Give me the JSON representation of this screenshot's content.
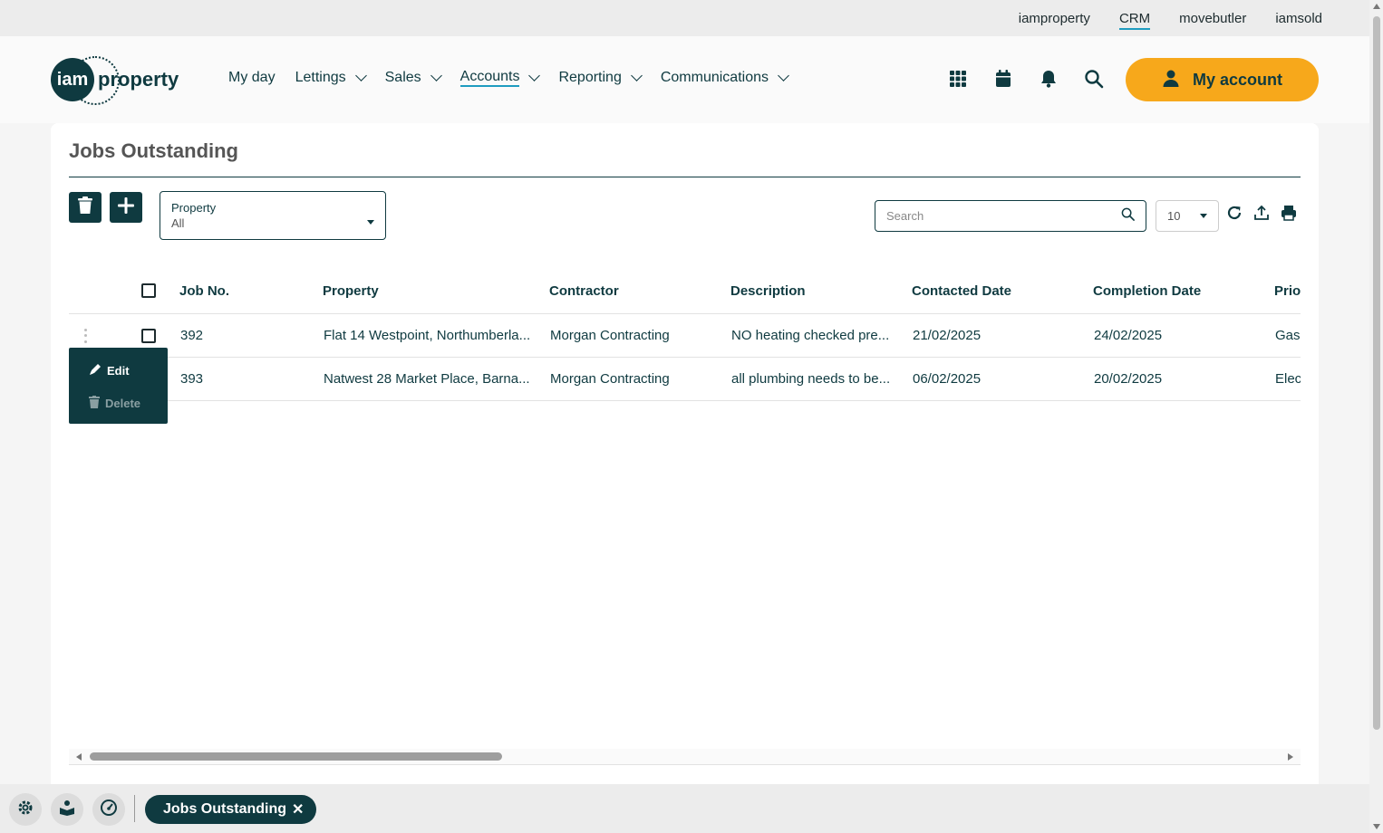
{
  "brand_links": [
    {
      "label": "iamproperty",
      "active": false
    },
    {
      "label": "CRM",
      "active": true
    },
    {
      "label": "movebutler",
      "active": false
    },
    {
      "label": "iamsold",
      "active": false
    }
  ],
  "logo": {
    "mark": "iam",
    "word": "property"
  },
  "nav": {
    "items": [
      {
        "label": "My day",
        "dropdown": false,
        "active": false
      },
      {
        "label": "Lettings",
        "dropdown": true,
        "active": false
      },
      {
        "label": "Sales",
        "dropdown": true,
        "active": false
      },
      {
        "label": "Accounts",
        "dropdown": true,
        "active": true
      },
      {
        "label": "Reporting",
        "dropdown": true,
        "active": false
      },
      {
        "label": "Communications",
        "dropdown": true,
        "active": false
      }
    ],
    "icons": [
      "apps-grid-icon",
      "calendar-icon",
      "bell-icon",
      "search-icon"
    ],
    "account_label": "My account"
  },
  "page": {
    "title": "Jobs Outstanding",
    "filter": {
      "label": "Property",
      "value": "All"
    },
    "search_placeholder": "Search",
    "page_size": "10"
  },
  "table": {
    "headers": [
      "Job No.",
      "Property",
      "Contractor",
      "Description",
      "Contacted Date",
      "Completion Date",
      "Prio"
    ],
    "rows": [
      {
        "job": "392",
        "property": "Flat 14 Westpoint, Northumberla...",
        "contractor": "Morgan Contracting",
        "description": "NO heating checked pre...",
        "contacted": "21/02/2025",
        "completion": "24/02/2025",
        "prio": "Gas"
      },
      {
        "job": "393",
        "property": "Natwest 28 Market Place, Barna...",
        "contractor": "Morgan Contracting",
        "description": "all plumbing needs to be...",
        "contacted": "06/02/2025",
        "completion": "20/02/2025",
        "prio": "Elec"
      }
    ]
  },
  "context_menu": {
    "edit": "Edit",
    "delete": "Delete"
  },
  "bottom": {
    "tab_label": "Jobs Outstanding",
    "tab_close": "✕"
  },
  "colors": {
    "primary": "#0f3a40",
    "accent": "#f7a81b",
    "link_underline": "#1f9cc0"
  }
}
